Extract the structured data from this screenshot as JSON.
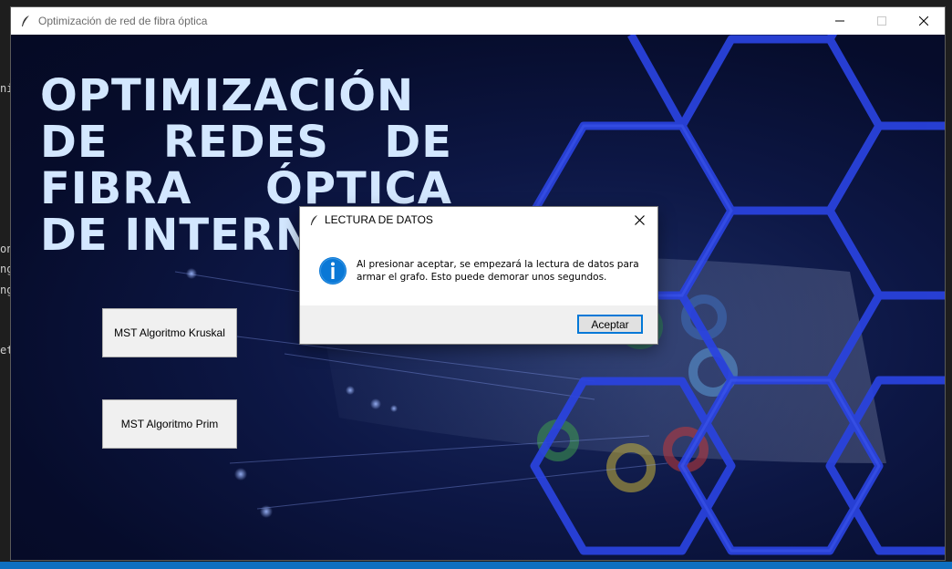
{
  "background_editor": {
    "fragments": [
      "nin",
      "on",
      "ng",
      "ng",
      "et.p"
    ]
  },
  "window": {
    "title": "Optimización de red de fibra óptica",
    "icon": "feather-icon",
    "controls": [
      "minimize-icon",
      "maximize-icon",
      "close-icon"
    ]
  },
  "headline": {
    "line1": "OPTIMIZACIÓN",
    "line2_words": [
      "DE",
      "REDES",
      "DE"
    ],
    "line3_words": [
      "FIBRA",
      "ÓPTICA"
    ],
    "line4": "DE INTERNET"
  },
  "buttons": {
    "kruskal": "MST Algoritmo Kruskal",
    "prim": "MST Algoritmo Prim"
  },
  "dialog": {
    "title": "LECTURA DE DATOS",
    "icon": "info-icon",
    "message_line1": "Al presionar aceptar, se empezará la lectura de datos para",
    "message_line2": "armar el grafo. Esto puede demorar unos segundos.",
    "ok_label": "Aceptar"
  },
  "colors": {
    "headline": "#d3e7ff",
    "hexagon_lines": "#2a43e0",
    "info_icon": "#0a78d6",
    "taskbar": "#0e6fc0"
  }
}
